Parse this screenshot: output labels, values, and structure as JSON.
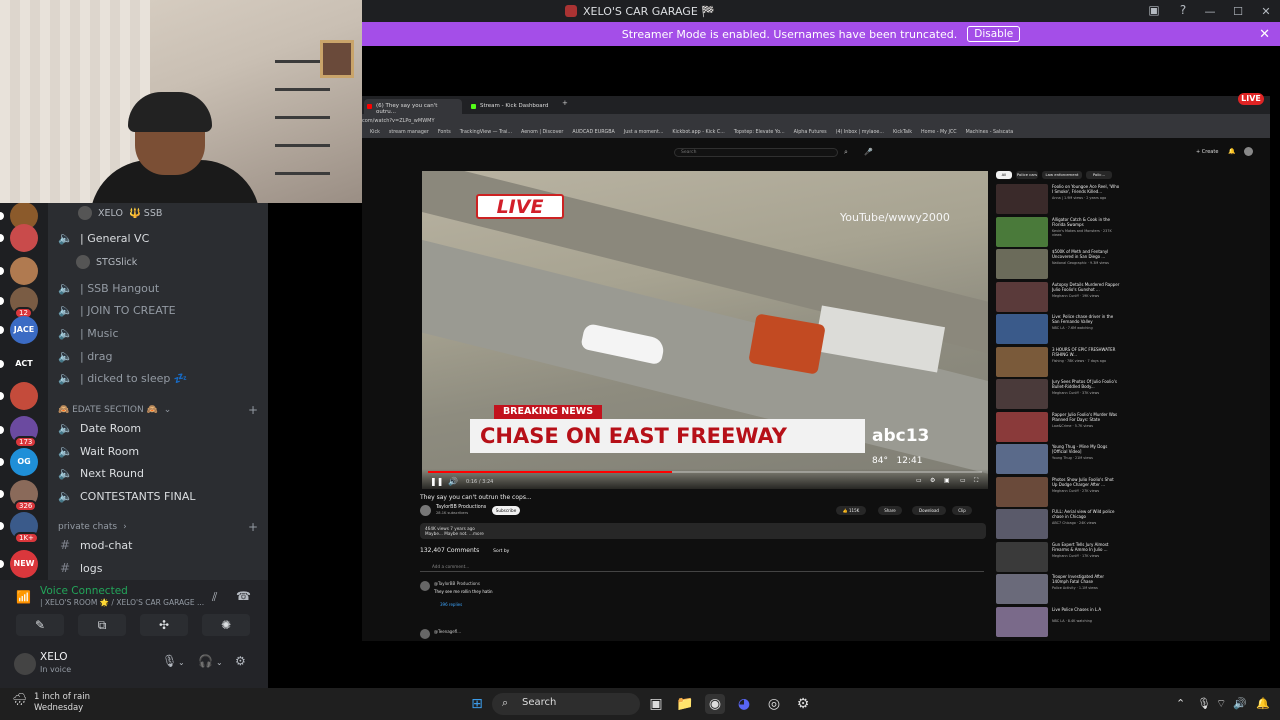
{
  "window": {
    "title": "XELO'S CAR GARAGE 🏁",
    "controls": [
      "—",
      "☐",
      "✕"
    ]
  },
  "banner": {
    "text": "Streamer Mode is enabled. Usernames have been truncated.",
    "button": "Disable",
    "close": "✕"
  },
  "guilds": [
    {
      "label": "",
      "badge": "",
      "color": "#8b5a2b"
    },
    {
      "label": "",
      "badge": "",
      "color": "#c94b4b"
    },
    {
      "label": "",
      "badge": "",
      "color": "#b07a50"
    },
    {
      "label": "",
      "badge": "12",
      "color": "#7a5c44"
    },
    {
      "label": "JACE",
      "badge": "",
      "color": "#3b6bc4"
    },
    {
      "label": "ACT",
      "badge": "",
      "color": "#1e1f22"
    },
    {
      "label": "",
      "badge": "",
      "color": "#c44b3b"
    },
    {
      "label": "",
      "badge": "173",
      "color": "#6b4aa0"
    },
    {
      "label": "OG",
      "badge": "",
      "color": "#1f8fd8"
    },
    {
      "label": "",
      "badge": "326",
      "color": "#8a6a5a"
    },
    {
      "label": "",
      "badge": "1K+",
      "color": "#3a5a8a"
    },
    {
      "label": "NEW",
      "badge": "",
      "color": "#da373c"
    }
  ],
  "sidebar": {
    "users_top": [
      {
        "name": "XELO",
        "tag": "🔱 SSB"
      }
    ],
    "voice_channels": [
      {
        "label": "| General VC"
      },
      {
        "label": "| SSB Hangout"
      },
      {
        "label": "| JOIN TO CREATE"
      },
      {
        "label": "| Music"
      },
      {
        "label": "| drag"
      },
      {
        "label": "| dicked to sleep 💤"
      }
    ],
    "general_user": "STGSlick",
    "category_edate": "🙈 EDATE SECTION 🙈",
    "edate_channels": [
      {
        "label": "Date Room"
      },
      {
        "label": "Wait Room"
      },
      {
        "label": "Next Round"
      },
      {
        "label": "CONTESTANTS FINAL"
      }
    ],
    "category_private": "private chats",
    "private_channels": [
      {
        "label": "mod-chat"
      },
      {
        "label": "logs"
      }
    ]
  },
  "voice_panel": {
    "status": "Voice Connected",
    "room": "| XELO'S ROOM 🌟 / XELO'S CAR GARAGE ...",
    "buttons": [
      "camera-off",
      "screen-share",
      "activities",
      "soundboard"
    ]
  },
  "user_panel": {
    "name": "XELO",
    "status": "In voice"
  },
  "browser": {
    "tabs": [
      {
        "label": "(6) They say you can't outru...",
        "color": "#ff0000"
      },
      {
        "label": "Stream - Kick Dashboard",
        "color": "#53fc18"
      }
    ],
    "url": "com/watch?v=ZLPo_wMWMY",
    "bookmarks": [
      "Kick",
      "stream manager",
      "Fonts",
      "TrackingView — Trai...",
      "Aenom | Discover",
      "AUDCAD EURGBA",
      "Just a moment...",
      "Kickbot.app - Kick C...",
      "Topstep: Elevate Yo...",
      "Alpha Futures",
      "(4) Inbox | mylaoe...",
      "KickTalk",
      "Home - My JCC",
      "Machines - Salscata"
    ],
    "search_placeholder": "Search",
    "create_label": "+ Create"
  },
  "video": {
    "live_label": "LIVE",
    "watermark": "YouTube/wwwy2000",
    "breaking": "BREAKING NEWS",
    "headline": "CHASE ON EAST FREEWAY",
    "station": "abc13",
    "temp": "84°",
    "clock": "12:41",
    "time_readout": "0:16 / 3:24",
    "progress": 0.44,
    "title": "They say you can't outrun the cops...",
    "channel": "TaylorBB Productions",
    "channel_subs": "28.1K subscribers",
    "subscribe": "Subscribe",
    "likes": "115K",
    "share": "Share",
    "download": "Download",
    "clip": "Clip",
    "desc_line1": "464K views  7 years ago",
    "desc_line2": "Maybe... Maybe not. ...more",
    "comments_count": "132,407 Comments",
    "sort": "Sort by",
    "add_comment": "Add a comment...",
    "comments": [
      {
        "author": "@TaylorBB Productions",
        "text": "They see me rollin they hatin",
        "replies": "396 replies"
      },
      {
        "author": "@Teenagefl...",
        "text": "",
        "replies": ""
      }
    ]
  },
  "chips": [
    "All",
    "Police cars",
    "Law enforcement",
    "Polic..."
  ],
  "recommendations": [
    {
      "title": "Foolio on Youngoe Ace Reel, 'Who I Smoke', Friends Killed...",
      "meta": "Anna | 1.9M views · 2 years ago",
      "color": "#3a2a2a"
    },
    {
      "title": "Alligator Catch & Cook in the Florida Swamps",
      "meta": "Kevin's Makes and Monsters · 237K views",
      "color": "#4a7a3a"
    },
    {
      "title": "$500K of Meth and Fentanyl Uncovered in San Diego ...",
      "meta": "National Geographic · 9.3M views",
      "color": "#6b6b5a"
    },
    {
      "title": "Autopsy Details Murdered Rapper Julio Foolio's Gunshot ...",
      "meta": "Meghann Cuniff · 19K views",
      "color": "#5a3a3a"
    },
    {
      "title": "Live: Police chase driver in the San Fernando Valley",
      "meta": "NBC LA · 7.6M watching",
      "color": "#3a5a8a"
    },
    {
      "title": "3 HOURS OF EPIC FRESHWATER FISHING W...",
      "meta": "Fishing · 78K views · 7 days ago",
      "color": "#7a5a3a"
    },
    {
      "title": "Jury Sees Photos Of Julio Foolio's Bullet-Riddled Body...",
      "meta": "Meghann Cuniff · 37K views",
      "color": "#4a3a3a"
    },
    {
      "title": "Rapper Julio Foolio's Murder Was Planned For Days: State",
      "meta": "Law&Crime · 5.7K views",
      "color": "#8a3a3a"
    },
    {
      "title": "Young Thug - Mine My Dogs [Official Video]",
      "meta": "Young Thug · 21M views",
      "color": "#5a6a8a"
    },
    {
      "title": "Photos Show Julio Foolio's Shot Up Dodge Charger After ...",
      "meta": "Meghann Cuniff · 27K views",
      "color": "#6a4a3a"
    },
    {
      "title": "FULL: Aerial view of Wild police chase in Chicago",
      "meta": "ABC7 Chicago · 24K views",
      "color": "#5a5a6a"
    },
    {
      "title": "Gun Expert Tells Jury Almost Firearms & Ammo In Julio ...",
      "meta": "Meghann Cuniff · 17K views",
      "color": "#3a3a3a"
    },
    {
      "title": "Trooper Investigated After 140mph Fatal Chase",
      "meta": "Police Activity · 1.1M views",
      "color": "#6a6a7a"
    },
    {
      "title": "Live Police Chases in L.A",
      "meta": "NBC LA · 8.4K watching",
      "color": "#7a6a8a"
    }
  ],
  "live_badge": "LIVE",
  "taskbar": {
    "weather": "1 inch of rain",
    "day": "Wednesday",
    "search": "Search"
  }
}
